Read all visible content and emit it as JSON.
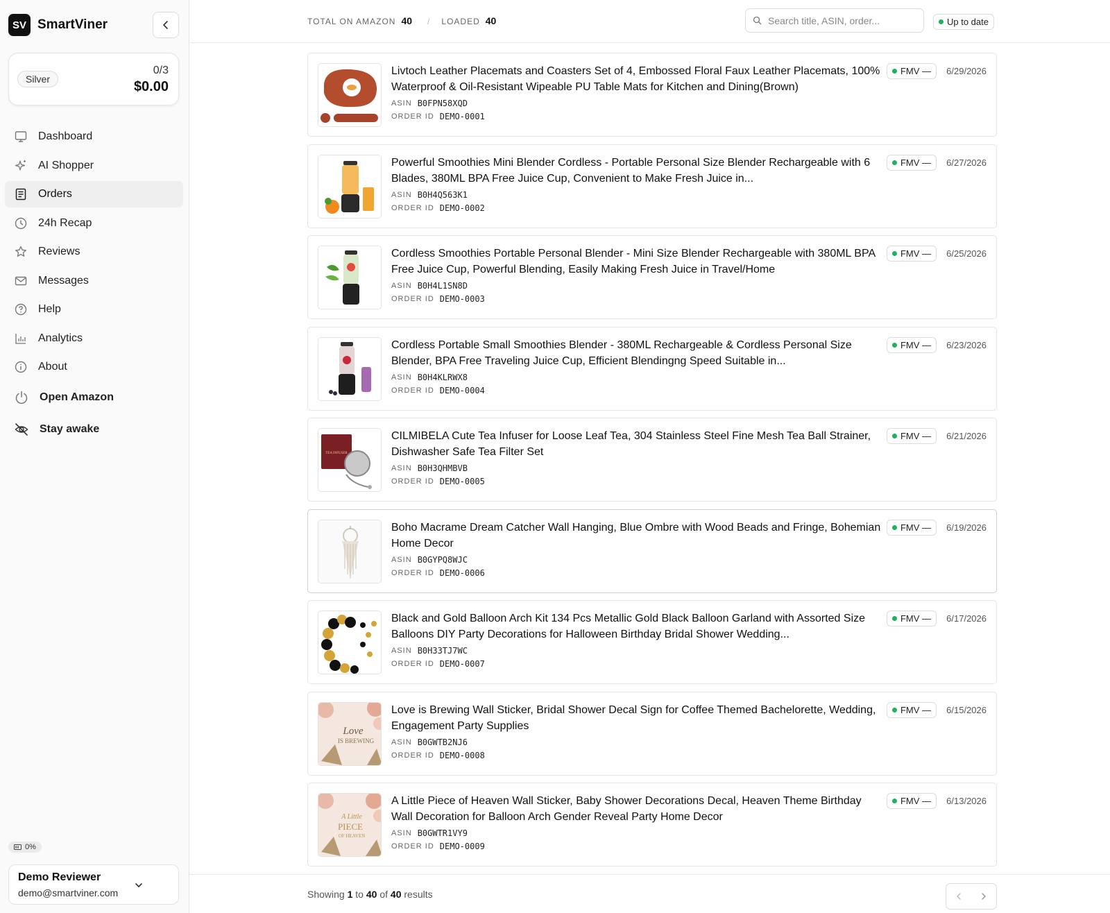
{
  "brand": {
    "logo": "SV",
    "name": "SmartViner"
  },
  "tier": {
    "badge": "Silver",
    "count": "0/3",
    "amount": "$0.00"
  },
  "nav": [
    {
      "label": "Dashboard",
      "icon": "monitor-icon",
      "active": false
    },
    {
      "label": "AI Shopper",
      "icon": "sparkles-icon",
      "active": false
    },
    {
      "label": "Orders",
      "icon": "receipt-icon",
      "active": true
    },
    {
      "label": "24h Recap",
      "icon": "clock-icon",
      "active": false
    },
    {
      "label": "Reviews",
      "icon": "star-icon",
      "active": false
    },
    {
      "label": "Messages",
      "icon": "mail-icon",
      "active": false
    },
    {
      "label": "Help",
      "icon": "help-circle-icon",
      "active": false
    },
    {
      "label": "Analytics",
      "icon": "bar-chart-icon",
      "active": false
    },
    {
      "label": "About",
      "icon": "info-icon",
      "active": false
    }
  ],
  "actions": {
    "open_amazon": "Open Amazon",
    "stay_awake": "Stay awake"
  },
  "usage": {
    "label": "0%"
  },
  "user": {
    "name": "Demo Reviewer",
    "email": "demo@smartviner.com"
  },
  "header": {
    "total_label": "TOTAL ON AMAZON",
    "total_value": "40",
    "separator": "/",
    "loaded_label": "LOADED",
    "loaded_value": "40",
    "search_placeholder": "Search title, ASIN, order...",
    "sync_status": "Up to date"
  },
  "labels": {
    "asin": "ASIN",
    "order_id": "ORDER ID",
    "fmv": "FMV —"
  },
  "colors": {
    "status_green": "#1fb25a",
    "accent": "#111111"
  },
  "orders": [
    {
      "title": "Livtoch Leather Placemats and Coasters Set of 4, Embossed Floral Faux Leather Placemats, 100% Waterproof & Oil-Resistant Wipeable PU Table Mats for Kitchen and Dining(Brown)",
      "asin": "B0FPN58XQD",
      "order_id": "DEMO-0001",
      "date": "6/29/2026",
      "image": "placemat"
    },
    {
      "title": "Powerful Smoothies Mini Blender Cordless - Portable Personal Size Blender Rechargeable with 6 Blades, 380ML BPA Free Juice Cup, Convenient to Make Fresh Juice in...",
      "asin": "B0H4Q563K1",
      "order_id": "DEMO-0002",
      "date": "6/27/2026",
      "image": "blender-orange"
    },
    {
      "title": "Cordless Smoothies Portable Personal Blender - Mini Size Blender Rechargeable with 380ML BPA Free Juice Cup, Powerful Blending, Easily Making Fresh Juice in Travel/Home",
      "asin": "B0H4L1SN8D",
      "order_id": "DEMO-0003",
      "date": "6/25/2026",
      "image": "blender-green"
    },
    {
      "title": "Cordless Portable Small Smoothies Blender - 380ML Rechargeable & Cordless Personal Size Blender, BPA Free Traveling Juice Cup, Efficient Blendingng Speed Suitable in...",
      "asin": "B0H4KLRWX8",
      "order_id": "DEMO-0004",
      "date": "6/23/2026",
      "image": "blender-berry"
    },
    {
      "title": "CILMIBELA Cute Tea Infuser for Loose Leaf Tea, 304 Stainless Steel Fine Mesh Tea Ball Strainer, Dishwasher Safe Tea Filter Set",
      "asin": "B0H3QHMBVB",
      "order_id": "DEMO-0005",
      "date": "6/21/2026",
      "image": "tea-infuser"
    },
    {
      "title": "Boho Macrame Dream Catcher Wall Hanging, Blue Ombre with Wood Beads and Fringe, Bohemian Home Decor",
      "asin": "B0GYPQ8WJC",
      "order_id": "DEMO-0006",
      "date": "6/19/2026",
      "image": "macrame"
    },
    {
      "title": "Black and Gold Balloon Arch Kit 134 Pcs Metallic Gold Black Balloon Garland with Assorted Size Balloons DIY Party Decorations for Halloween Birthday Bridal Shower Wedding...",
      "asin": "B0H33TJ7WC",
      "order_id": "DEMO-0007",
      "date": "6/17/2026",
      "image": "balloons"
    },
    {
      "title": "Love is Brewing Wall Sticker, Bridal Shower Decal Sign for Coffee Themed Bachelorette, Wedding, Engagement Party Supplies",
      "asin": "B0GWTB2NJ6",
      "order_id": "DEMO-0008",
      "date": "6/15/2026",
      "image": "sticker-love"
    },
    {
      "title": "A Little Piece of Heaven Wall Sticker, Baby Shower Decorations Decal, Heaven Theme Birthday Wall Decoration for Balloon Arch Gender Reveal Party Home Decor",
      "asin": "B0GWTR1VY9",
      "order_id": "DEMO-0009",
      "date": "6/13/2026",
      "image": "sticker-heaven"
    }
  ],
  "thumb_text": {
    "tea_box": "TEA INFUSER",
    "love_line1": "Love",
    "love_line2": "IS BREWING",
    "heaven_line1": "A Little",
    "heaven_line2": "PIECE",
    "heaven_line3": "OF HEAVEN"
  },
  "footer": {
    "showing": "Showing",
    "from": "1",
    "to_word": "to",
    "to": "40",
    "of_word": "of",
    "total": "40",
    "results": "results"
  }
}
